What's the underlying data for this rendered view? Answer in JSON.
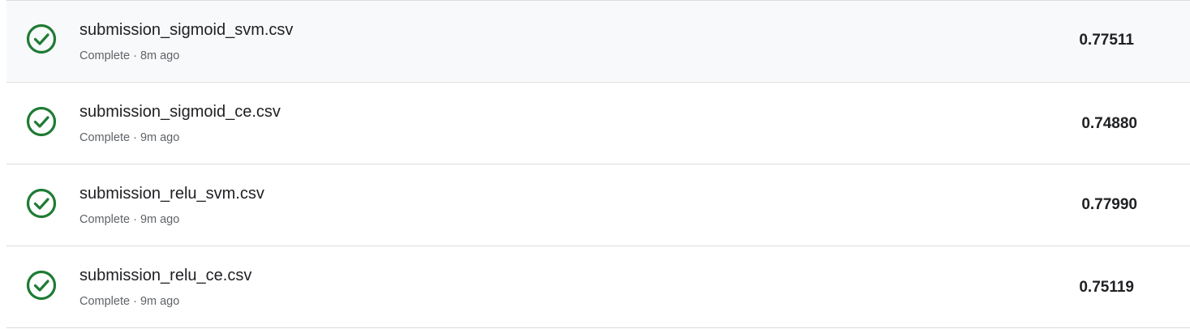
{
  "submissions": [
    {
      "filename": "submission_sigmoid_svm.csv",
      "status": "Complete",
      "time": "8m ago",
      "meta": "Complete · 8m ago",
      "score": "0.77511",
      "icon": "check-circle-icon"
    },
    {
      "filename": "submission_sigmoid_ce.csv",
      "status": "Complete",
      "time": "9m ago",
      "meta": "Complete · 9m ago",
      "score": "0.74880",
      "icon": "check-circle-icon"
    },
    {
      "filename": "submission_relu_svm.csv",
      "status": "Complete",
      "time": "9m ago",
      "meta": "Complete · 9m ago",
      "score": "0.77990",
      "icon": "check-circle-icon"
    },
    {
      "filename": "submission_relu_ce.csv",
      "status": "Complete",
      "time": "9m ago",
      "meta": "Complete · 9m ago",
      "score": "0.75119",
      "icon": "check-circle-icon"
    }
  ],
  "colors": {
    "success": "#1e7b34",
    "hover_row": "#f8f9fa",
    "divider": "#dadce0",
    "secondary_text": "#5f6368"
  }
}
